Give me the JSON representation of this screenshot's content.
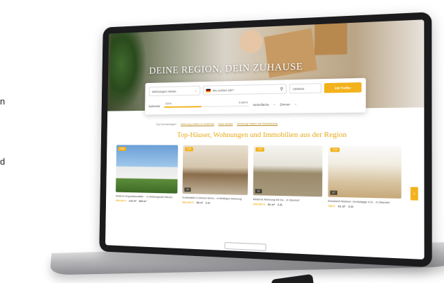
{
  "side_text": {
    "line1": "n",
    "line2": "d"
  },
  "hero": {
    "title": "DEINE REGION, DEIN ZUHAUSE"
  },
  "search": {
    "type_value": "Wohnungen mieten",
    "location_placeholder": "Wo suchen Sie?",
    "radius_value": "Umkreis",
    "submit_label": "103 Treffer",
    "price_label": "Kaltmiete",
    "price_min": "100 €",
    "price_max": "5.000 €",
    "price_fill": 0.45,
    "area_label": "Wohnfläche",
    "rooms_label": "Zimmer"
  },
  "links": [
    {
      "label": "Top-Suchanfragen:",
      "link": false
    },
    {
      "label": "Wohnung mieten in Chemnitz",
      "link": true
    },
    {
      "label": "Haus kaufen",
      "link": true
    },
    {
      "label": "Wohnung mieten mit Einbauküche",
      "link": true
    }
  ],
  "section_title": "Top-Häuser, Wohnungen und Immobilien aus der Region",
  "cards": [
    {
      "badge": "TOP",
      "desc": "Moderne Doppelhaushälfte ... in Wörthingebiet Rilmoto",
      "price": "399.000 €",
      "area": "133 m²",
      "plot": "383 m²",
      "rooms": "",
      "counter": ""
    },
    {
      "badge": "TOP",
      "desc": "Komfortable 3-Zimmer-Wohn... in Wörthgen Wohnung",
      "price": "899.000 €",
      "area": "98 m²",
      "plot": "",
      "rooms": "3 Zi.",
      "counter": "24"
    },
    {
      "badge": "TOP",
      "desc": "Moderne Wohnung mit Ga... in Überdorf",
      "price": "449.000 €",
      "area": "81 m²",
      "plot": "",
      "rooms": "3 Zi.",
      "counter": "22"
    },
    {
      "badge": "TOP",
      "desc": "Einzeldorf Wohnen: Großzügige 4-Zi... in Überdorf",
      "price": "799 €",
      "area": "91 m²",
      "plot": "",
      "rooms": "3 Zi.",
      "counter": "27"
    }
  ],
  "icons": {
    "flag": "german-flag-icon",
    "pin": "location-pin-icon",
    "arrow": "chevron-right-icon"
  },
  "colors": {
    "accent": "#f3b21b",
    "title": "#e6a817",
    "bezel": "#1b1b1d"
  }
}
